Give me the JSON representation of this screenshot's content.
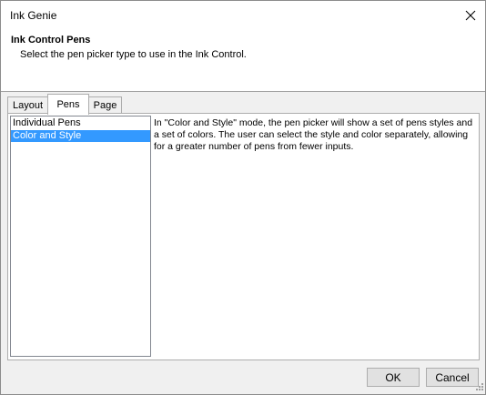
{
  "window": {
    "title": "Ink Genie"
  },
  "header": {
    "title": "Ink Control Pens",
    "subtitle": "Select the pen picker type to use in the Ink Control."
  },
  "tabs": [
    {
      "label": "Layout",
      "active": false
    },
    {
      "label": "Pens",
      "active": true
    },
    {
      "label": "Page",
      "active": false
    }
  ],
  "pen_types": {
    "items": [
      {
        "label": "Individual Pens",
        "selected": false
      },
      {
        "label": "Color and Style",
        "selected": true
      }
    ]
  },
  "description": "In \"Color and Style\" mode, the pen picker will show a set of pens styles and a set of colors. The user can select the style and color separately, allowing for a greater number of pens from fewer inputs.",
  "buttons": {
    "ok": "OK",
    "cancel": "Cancel"
  },
  "colors": {
    "selection": "#3399ff",
    "dialog_bg": "#f0f0f0",
    "button_bg": "#e1e1e1"
  },
  "icons": {
    "close": "close-icon",
    "grip": "resize-grip-icon"
  }
}
